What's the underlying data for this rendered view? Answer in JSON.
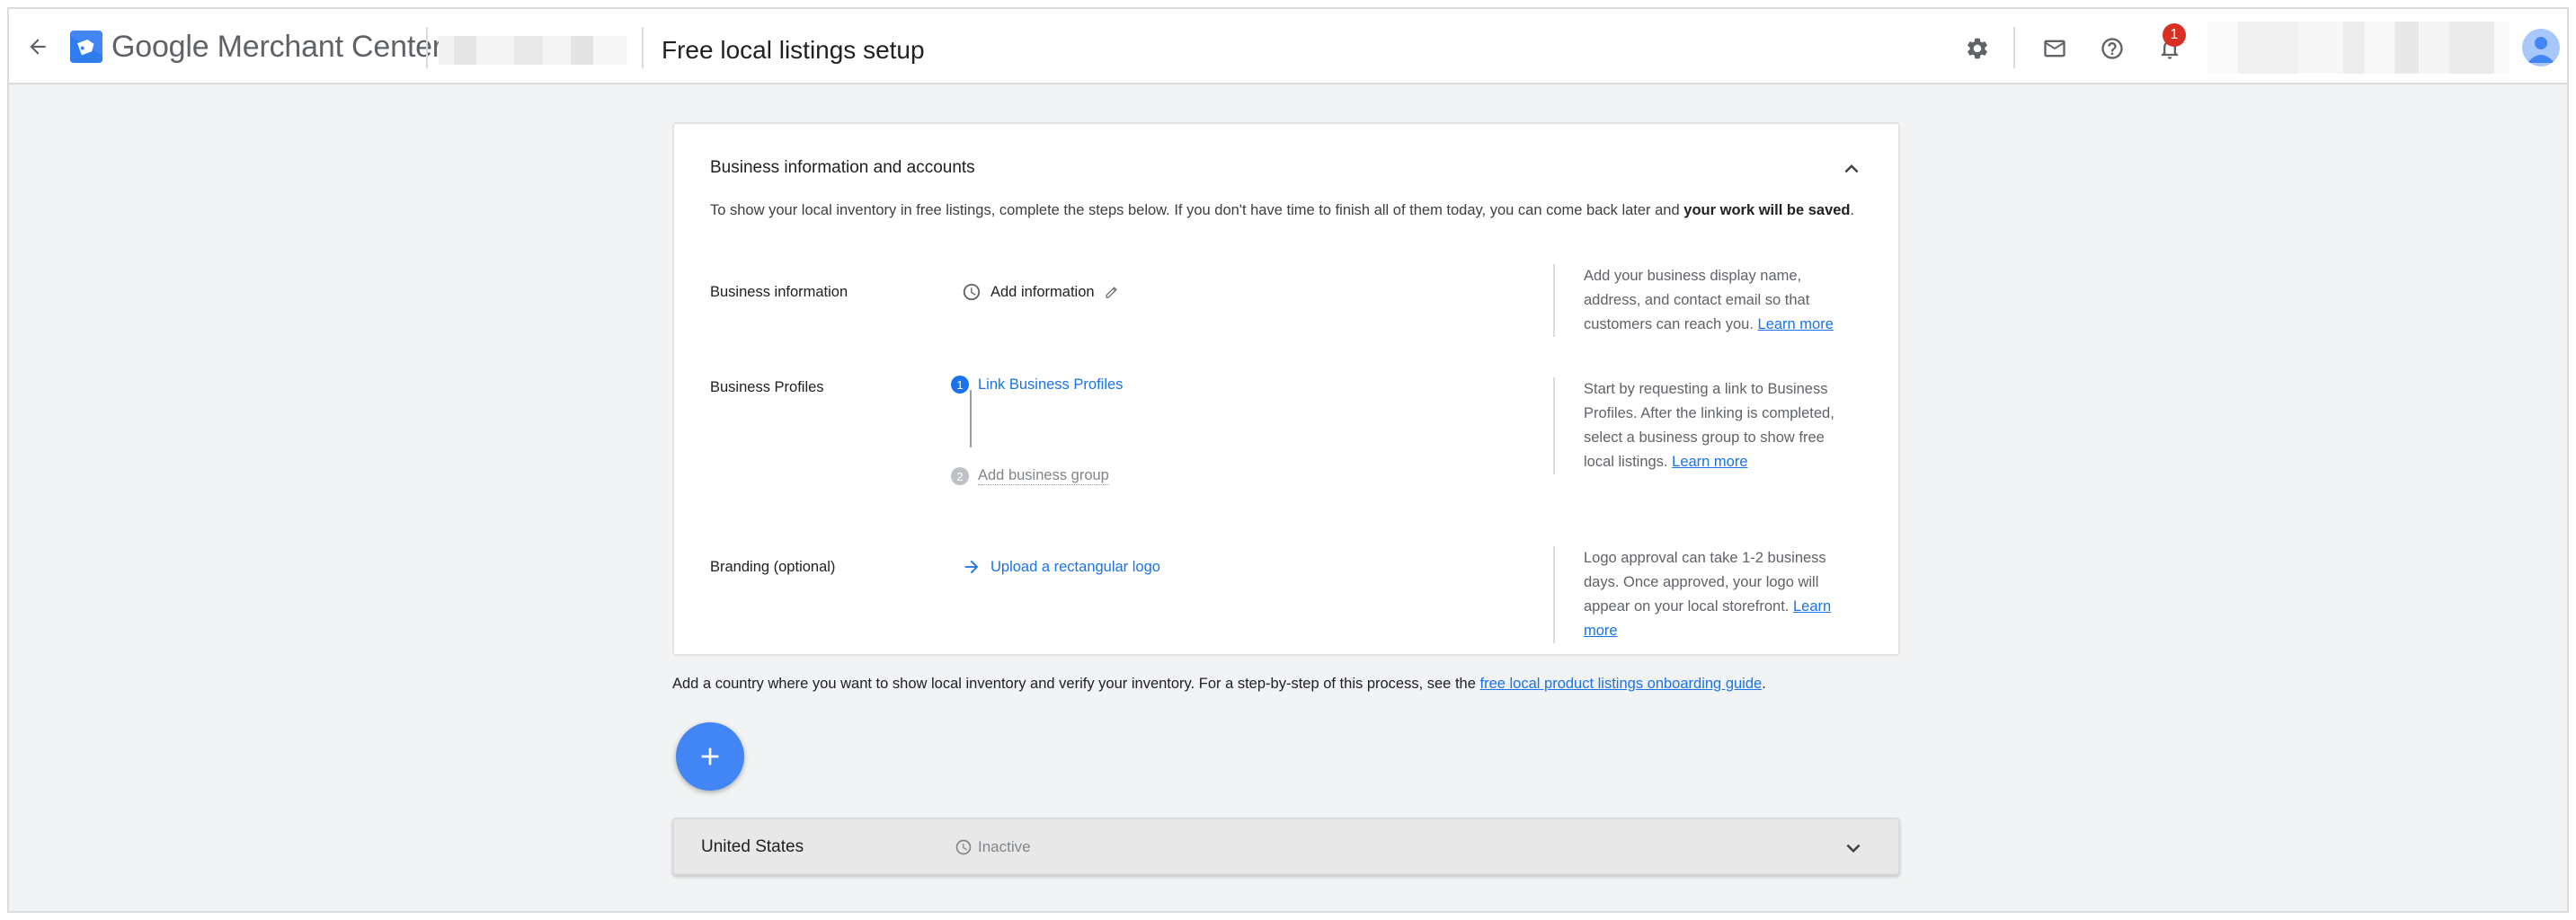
{
  "header": {
    "back_icon": "arrow-back-icon",
    "brand_name": "Google Merchant Center",
    "page_title": "Free local listings setup",
    "notification_count": "1",
    "icons": [
      "settings-icon",
      "mail-icon",
      "help-icon",
      "notifications-icon",
      "avatar"
    ]
  },
  "card": {
    "title": "Business information and accounts",
    "intro_text": "To show your local inventory in free listings, complete the steps below. If you don't have time to finish all of them today, you can come back later and",
    "intro_bold": "your work will be saved",
    "intro_end": ".",
    "rows": [
      {
        "label": "Business information",
        "action": "Add information",
        "help": "Add your business display name, address, and contact email so that customers can reach you.",
        "help_link": "Learn more"
      },
      {
        "label": "Business Profiles",
        "steps": [
          {
            "num": "1",
            "text": "Link Business Profiles"
          },
          {
            "num": "2",
            "text": "Add business group"
          }
        ],
        "help": "Start by requesting a link to Business Profiles. After the linking is completed, select a business group to show free local listings.",
        "help_link": "Learn more"
      },
      {
        "label": "Branding (optional)",
        "action": "Upload a rectangular logo",
        "help": "Logo approval can take 1-2 business days. Once approved, your logo will appear on your local storefront.",
        "help_link": "Learn more"
      }
    ]
  },
  "country_section": {
    "text": "Add a country where you want to show local inventory and verify your inventory. For a step-by-step of this process, see the",
    "link": "free local product listings onboarding guide",
    "text_end": "."
  },
  "country_row": {
    "name": "United States",
    "status": "Inactive"
  },
  "colors": {
    "accent": "#1a73e8",
    "fab": "#4285f4",
    "badge": "#d93025"
  }
}
